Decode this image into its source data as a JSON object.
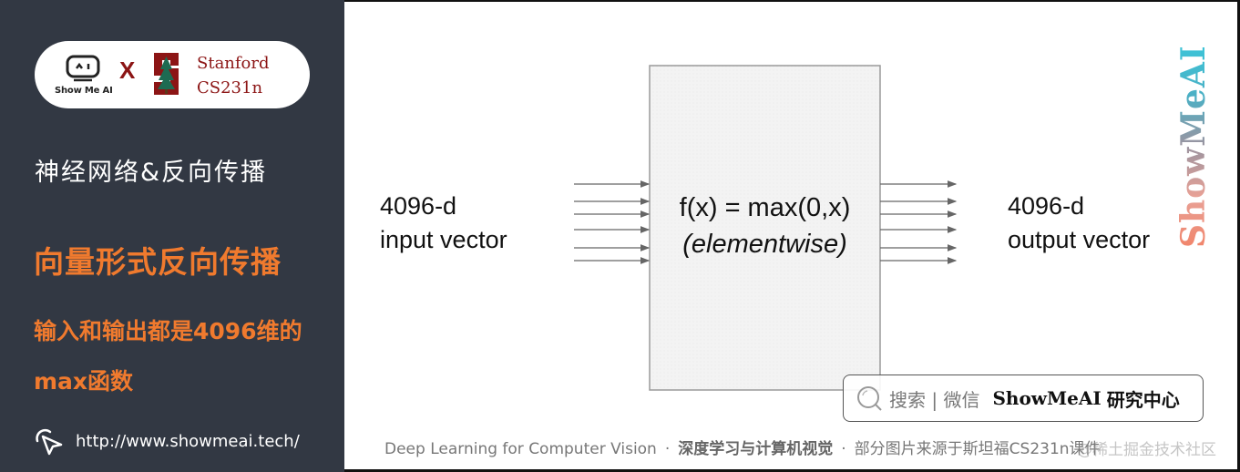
{
  "sidebar": {
    "logo": {
      "showmeai_label": "Show Me AI",
      "cross": "X",
      "partner_line1": "Stanford",
      "partner_line2": "CS231n"
    },
    "subtitle": "神经网络&反向传播",
    "title": "向量形式反向传播",
    "description": "输入和输出都是4096维的max函数",
    "link": "http://www.showmeai.tech/"
  },
  "diagram": {
    "input_label_line1": "4096-d",
    "input_label_line2": "input vector",
    "function_line1": "f(x) = max(0,x)",
    "function_line2": "(elementwise)",
    "output_label_line1": "4096-d",
    "output_label_line2": "output vector",
    "input_arrow_count": 6,
    "output_arrow_count": 6
  },
  "watermark": "ShowMeAI",
  "search": {
    "hint": "搜索 | 微信",
    "brand": "ShowMeAI",
    "brand_suffix": "研究中心"
  },
  "footer": {
    "course_en": "Deep Learning for Computer Vision",
    "separator": "·",
    "course_cn": "深度学习与计算机视觉",
    "credit": "部分图片来源于斯坦福CS231n课件",
    "overlay_watermark": "@稀土掘金技术社区"
  },
  "colors": {
    "sidebar_bg": "#323843",
    "accent_orange": "#f07a2e",
    "stanford_red": "#8c1515",
    "box_fill": "#f2f2f2",
    "arrow": "#666666"
  }
}
